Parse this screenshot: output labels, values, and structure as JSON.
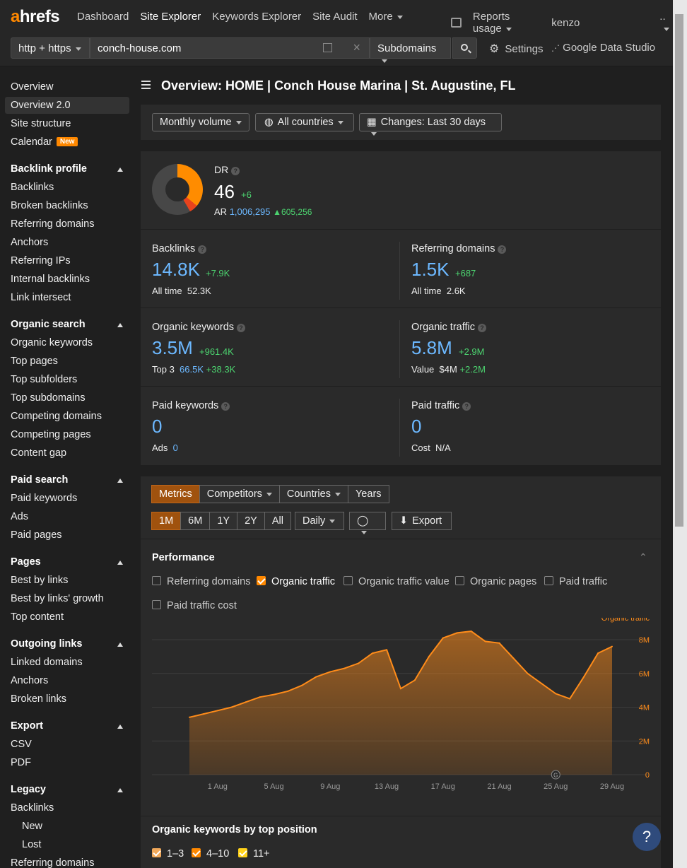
{
  "brand": {
    "logo_a": "a",
    "logo_rest": "hrefs"
  },
  "nav": {
    "items": [
      "Dashboard",
      "Site Explorer",
      "Keywords Explorer",
      "Site Audit",
      "More"
    ],
    "reports_usage": "Reports usage",
    "user": "kenzo",
    "dots": ".."
  },
  "search": {
    "protocol": "http + https",
    "url": "conch-house.com",
    "mode": "Subdomains",
    "settings": "Settings",
    "gds": "Google Data Studio"
  },
  "sidebar": {
    "top": [
      "Overview",
      "Overview 2.0",
      "Site structure",
      "Calendar"
    ],
    "new_badge": "New",
    "sections": [
      {
        "title": "Backlink profile",
        "items": [
          "Backlinks",
          "Broken backlinks",
          "Referring domains",
          "Anchors",
          "Referring IPs",
          "Internal backlinks",
          "Link intersect"
        ]
      },
      {
        "title": "Organic search",
        "items": [
          "Organic keywords",
          "Top pages",
          "Top subfolders",
          "Top subdomains",
          "Competing domains",
          "Competing pages",
          "Content gap"
        ]
      },
      {
        "title": "Paid search",
        "items": [
          "Paid keywords",
          "Ads",
          "Paid pages"
        ]
      },
      {
        "title": "Pages",
        "items": [
          "Best by links",
          "Best by links' growth",
          "Top content"
        ]
      },
      {
        "title": "Outgoing links",
        "items": [
          "Linked domains",
          "Anchors",
          "Broken links"
        ]
      },
      {
        "title": "Export",
        "items": [
          "CSV",
          "PDF"
        ]
      },
      {
        "title": "Legacy",
        "items": [
          "Backlinks",
          "New",
          "Lost",
          "Referring domains"
        ]
      }
    ]
  },
  "page": {
    "title": "Overview: HOME | Conch House Marina | St. Augustine, FL"
  },
  "filters": {
    "volume": "Monthly volume",
    "countries": "All countries",
    "changes": "Changes: Last 30 days"
  },
  "dr": {
    "label": "DR",
    "value": "46",
    "delta": "+6",
    "ar_label": "AR",
    "ar_value": "1,006,295",
    "ar_delta": "605,256",
    "fraction": 0.46
  },
  "metrics": {
    "backlinks": {
      "label": "Backlinks",
      "value": "14.8K",
      "delta": "+7.9K",
      "sub_label": "All time",
      "sub_value": "52.3K"
    },
    "refdomains": {
      "label": "Referring domains",
      "value": "1.5K",
      "delta": "+687",
      "sub_label": "All time",
      "sub_value": "2.6K"
    },
    "orgkw": {
      "label": "Organic keywords",
      "value": "3.5M",
      "delta": "+961.4K",
      "sub_label": "Top 3",
      "sub_value": "66.5K",
      "sub_delta": "+38.3K"
    },
    "orgtraffic": {
      "label": "Organic traffic",
      "value": "5.8M",
      "delta": "+2.9M",
      "sub_label": "Value",
      "sub_value": "$4M",
      "sub_delta": "+2.2M"
    },
    "paidkw": {
      "label": "Paid keywords",
      "value": "0",
      "sub_label": "Ads",
      "sub_value": "0"
    },
    "paidtraffic": {
      "label": "Paid traffic",
      "value": "0",
      "sub_label": "Cost",
      "sub_value": "N/A"
    }
  },
  "chart_panel": {
    "tabs": [
      "Metrics",
      "Competitors",
      "Countries",
      "Years"
    ],
    "ranges": [
      "1M",
      "6M",
      "1Y",
      "2Y",
      "All"
    ],
    "granularity": "Daily",
    "export": "Export",
    "section_title": "Performance",
    "checks": [
      {
        "label": "Referring domains",
        "checked": false
      },
      {
        "label": "Organic traffic",
        "checked": true
      },
      {
        "label": "Organic traffic value",
        "checked": false
      },
      {
        "label": "Organic pages",
        "checked": false
      },
      {
        "label": "Paid traffic",
        "checked": false
      },
      {
        "label": "Paid traffic cost",
        "checked": false
      }
    ],
    "bottom_title": "Organic keywords by top position",
    "bottom_checks": [
      "1–3",
      "4–10",
      "11+"
    ]
  },
  "chart_data": {
    "type": "area",
    "series": [
      {
        "name": "Organic traffic",
        "color": "#ff8c1a",
        "values": [
          3.4,
          3.6,
          3.8,
          4.0,
          4.3,
          4.6,
          4.75,
          4.95,
          5.3,
          5.8,
          6.1,
          6.3,
          6.6,
          7.2,
          7.4,
          5.1,
          5.6,
          7.0,
          8.1,
          8.4,
          8.5,
          7.9,
          7.8,
          6.9,
          6.0,
          5.4,
          4.8,
          4.5,
          5.8,
          7.2,
          7.6
        ]
      }
    ],
    "x": [
      "30 Jul",
      "31 Jul",
      "1 Aug",
      "2 Aug",
      "3 Aug",
      "4 Aug",
      "5 Aug",
      "6 Aug",
      "7 Aug",
      "8 Aug",
      "9 Aug",
      "10 Aug",
      "11 Aug",
      "12 Aug",
      "13 Aug",
      "14 Aug",
      "15 Aug",
      "16 Aug",
      "17 Aug",
      "18 Aug",
      "19 Aug",
      "20 Aug",
      "21 Aug",
      "22 Aug",
      "23 Aug",
      "24 Aug",
      "25 Aug",
      "26 Aug",
      "27 Aug",
      "28 Aug",
      "29 Aug"
    ],
    "xticks": [
      "1 Aug",
      "5 Aug",
      "9 Aug",
      "13 Aug",
      "17 Aug",
      "21 Aug",
      "25 Aug",
      "29 Aug"
    ],
    "yticks": [
      "0",
      "2M",
      "4M",
      "6M",
      "8M"
    ],
    "ylim": [
      0,
      8.5
    ],
    "ylabel": "Organic traffic",
    "annotation": "G"
  },
  "help": "?"
}
